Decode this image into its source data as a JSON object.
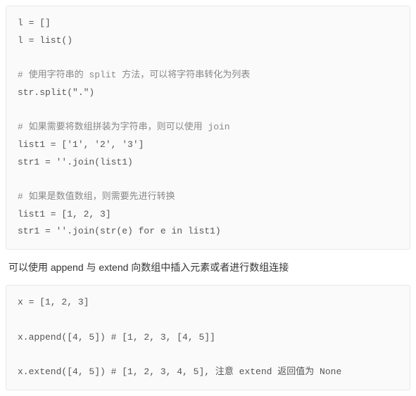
{
  "codeBlock1": {
    "line1": "l = []",
    "line2": "l = list()",
    "line3": "",
    "line4": "# 使用字符串的 split 方法，可以将字符串转化为列表",
    "line5": "str.split(\".\")",
    "line6": "",
    "line7": "# 如果需要将数组拼装为字符串，则可以使用 join",
    "line8": "list1 = ['1', '2', '3']",
    "line9": "str1 = ''.join(list1)",
    "line10": "",
    "line11": "# 如果是数值数组，则需要先进行转换",
    "line12": "list1 = [1, 2, 3]",
    "line13": "str1 = ''.join(str(e) for e in list1)"
  },
  "paragraph1": "可以使用 append 与 extend 向数组中插入元素或者进行数组连接",
  "codeBlock2": {
    "line1": "x = [1, 2, 3]",
    "line2": "",
    "line3": "x.append([4, 5]) # [1, 2, 3, [4, 5]]",
    "line4": "",
    "line5": "x.extend([4, 5]) # [1, 2, 3, 4, 5], 注意 extend 返回值为 None"
  }
}
